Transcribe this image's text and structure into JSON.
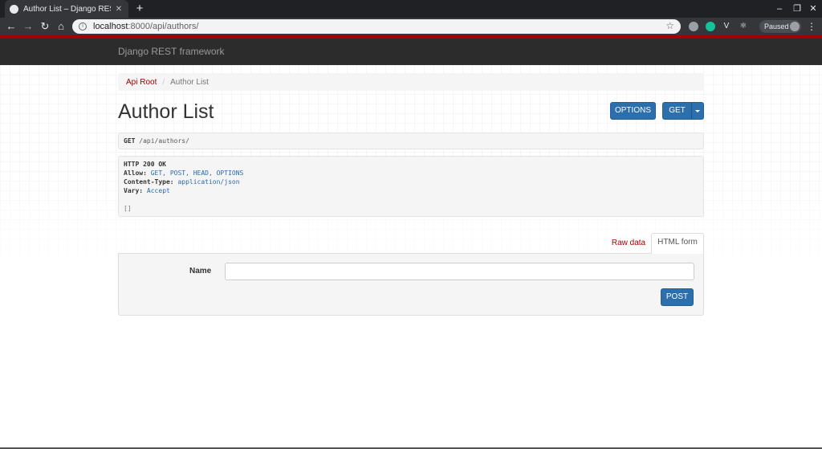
{
  "browser": {
    "tab_title": "Author List – Django REST fram",
    "new_tab_label": "+",
    "url_host": "localhost",
    "url_rest": ":8000/api/authors/",
    "profile_status": "Paused"
  },
  "navbar": {
    "brand": "Django REST framework"
  },
  "breadcrumb": {
    "root": "Api Root",
    "separator": "/",
    "current": "Author List"
  },
  "page": {
    "title": "Author List"
  },
  "buttons": {
    "options": "OPTIONS",
    "get": "GET",
    "post": "POST"
  },
  "request": {
    "method": "GET",
    "path": "/api/authors/"
  },
  "response": {
    "status": "HTTP 200 OK",
    "headers": [
      {
        "key": "Allow:",
        "value": "GET, POST, HEAD, OPTIONS"
      },
      {
        "key": "Content-Type:",
        "value": "application/json"
      },
      {
        "key": "Vary:",
        "value": "Accept"
      }
    ],
    "body": "[]"
  },
  "form_tabs": {
    "raw": "Raw data",
    "html": "HTML form"
  },
  "form": {
    "name_label": "Name",
    "name_value": ""
  },
  "colors": {
    "brand_red": "#a30000",
    "primary": "#2c6fad",
    "navbar": "#2c2c2c"
  }
}
